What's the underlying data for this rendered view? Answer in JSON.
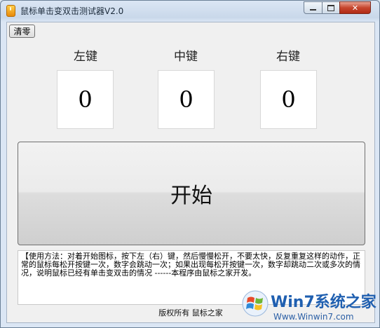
{
  "window": {
    "title": "鼠标单击变双击测试器V2.0"
  },
  "toolbar": {
    "reset_label": "清零"
  },
  "keys": [
    {
      "label": "左键",
      "count": "0"
    },
    {
      "label": "中键",
      "count": "0"
    },
    {
      "label": "右键",
      "count": "0"
    }
  ],
  "start": {
    "label": "开始"
  },
  "instructions": {
    "text": "【使用方法：对着开始图标，按下左（右）键，然后慢慢松开，不要太快，反复重复这样的动作，正常的鼠标每松开按键一次，数字会跳动一次；如果出现每松开按键一次，数字却跳动二次或多次的情况，说明鼠标已经有单击变双击的情况 ------本程序由鼠标之家开发。"
  },
  "footer": {
    "copyright": "版权所有 鼠标之家"
  },
  "watermark": {
    "title": "Win7系统之家",
    "url": "Www.Winwin7.com"
  }
}
